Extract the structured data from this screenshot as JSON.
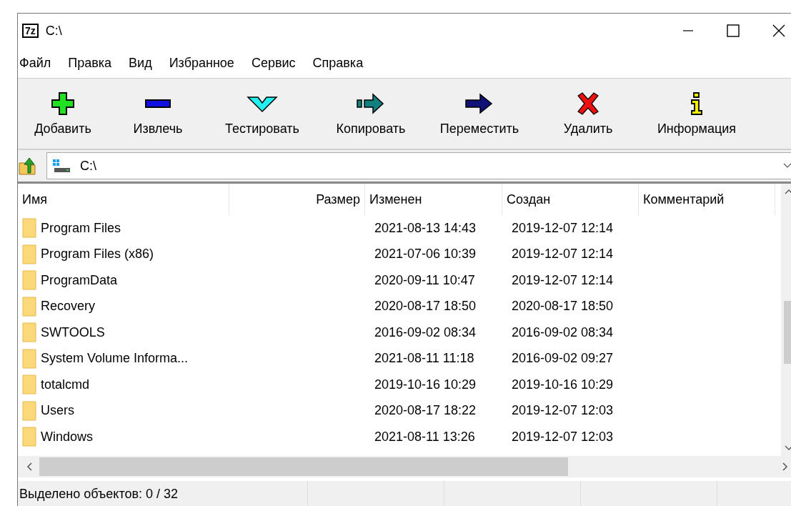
{
  "window": {
    "app_icon": "7z",
    "title": "C:\\"
  },
  "menu": [
    "Файл",
    "Правка",
    "Вид",
    "Избранное",
    "Сервис",
    "Справка"
  ],
  "toolbar": [
    {
      "kind": "add",
      "label": "Добавить"
    },
    {
      "kind": "extract",
      "label": "Извлечь"
    },
    {
      "kind": "test",
      "label": "Тестировать"
    },
    {
      "kind": "copy",
      "label": "Копировать"
    },
    {
      "kind": "move",
      "label": "Переместить"
    },
    {
      "kind": "delete",
      "label": "Удалить"
    },
    {
      "kind": "info",
      "label": "Информация"
    }
  ],
  "address": {
    "value": "C:\\"
  },
  "table": {
    "columns": [
      "Имя",
      "Размер",
      "Изменен",
      "Создан",
      "Комментарий"
    ],
    "rows": [
      {
        "name": "Program Files",
        "modified": "2021-08-13 14:43",
        "created": "2019-12-07 12:14"
      },
      {
        "name": "Program Files (x86)",
        "modified": "2021-07-06 10:39",
        "created": "2019-12-07 12:14"
      },
      {
        "name": "ProgramData",
        "modified": "2020-09-11 10:47",
        "created": "2019-12-07 12:14"
      },
      {
        "name": "Recovery",
        "modified": "2020-08-17 18:50",
        "created": "2020-08-17 18:50"
      },
      {
        "name": "SWTOOLS",
        "modified": "2016-09-02 08:34",
        "created": "2016-09-02 08:34"
      },
      {
        "name": "System Volume Informa...",
        "modified": "2021-08-11 11:18",
        "created": "2016-09-02 09:27"
      },
      {
        "name": "totalcmd",
        "modified": "2019-10-16 10:29",
        "created": "2019-10-16 10:29"
      },
      {
        "name": "Users",
        "modified": "2020-08-17 18:22",
        "created": "2019-12-07 12:03"
      },
      {
        "name": "Windows",
        "modified": "2021-08-11 13:26",
        "created": "2019-12-07 12:03"
      }
    ]
  },
  "status_bar": {
    "text": "Выделено объектов: 0 / 32"
  }
}
